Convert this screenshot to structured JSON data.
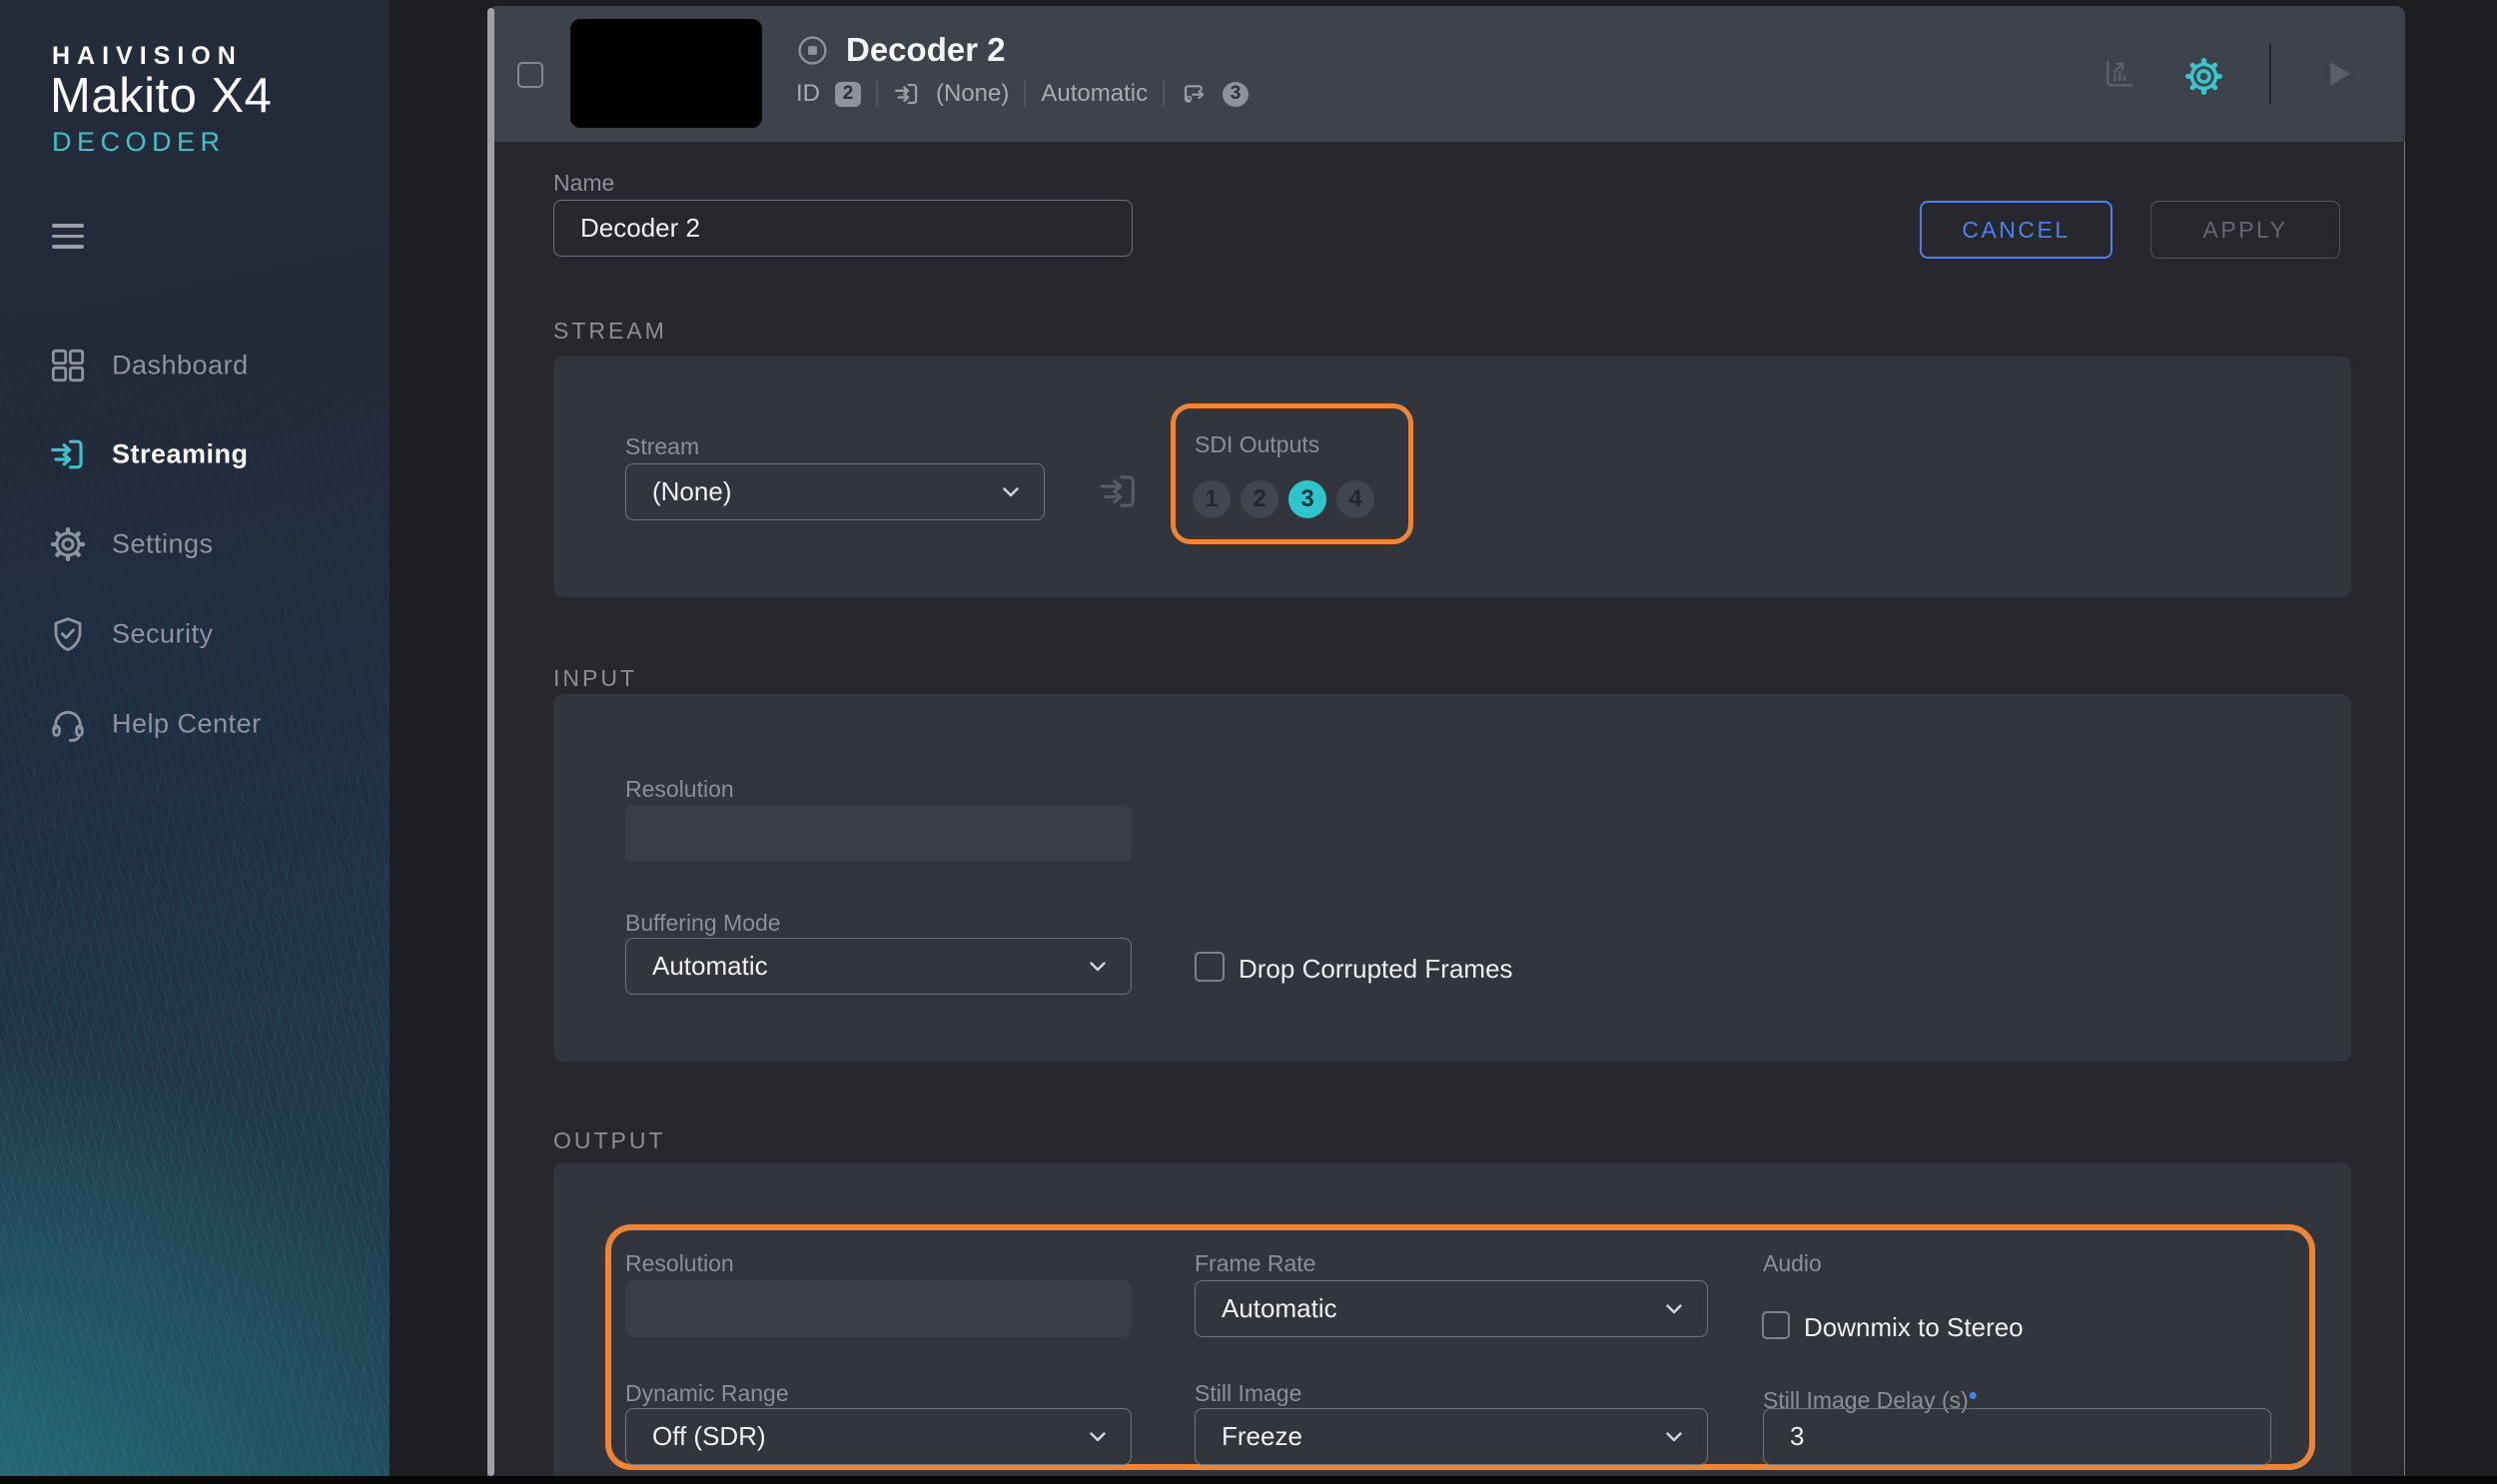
{
  "sidebar": {
    "brand": "HAIVISION",
    "product": "Makito X4",
    "mode": "DECODER",
    "items": [
      {
        "label": "Dashboard",
        "icon": "dashboard-icon",
        "active": false
      },
      {
        "label": "Streaming",
        "icon": "streaming-icon",
        "active": true
      },
      {
        "label": "Settings",
        "icon": "settings-icon",
        "active": false
      },
      {
        "label": "Security",
        "icon": "security-icon",
        "active": false
      },
      {
        "label": "Help Center",
        "icon": "help-center-icon",
        "active": false
      }
    ]
  },
  "panel": {
    "header": {
      "title": "Decoder 2",
      "id_label": "ID",
      "id_value": "2",
      "stream_value": "(None)",
      "mode_value": "Automatic",
      "outputs_count": "3"
    },
    "actions": {
      "cancel": "CANCEL",
      "apply": "APPLY"
    },
    "name": {
      "label": "Name",
      "value": "Decoder 2"
    }
  },
  "stream_section": {
    "heading": "STREAM",
    "stream_label": "Stream",
    "stream_value": "(None)",
    "sdi_label": "SDI Outputs",
    "sdi_outputs": [
      "1",
      "2",
      "3",
      "4"
    ],
    "sdi_active": "3"
  },
  "input_section": {
    "heading": "INPUT",
    "resolution_label": "Resolution",
    "resolution_value": "",
    "buffering_label": "Buffering Mode",
    "buffering_value": "Automatic",
    "drop_frames_label": "Drop Corrupted Frames",
    "drop_frames_checked": false
  },
  "output_section": {
    "heading": "OUTPUT",
    "resolution_label": "Resolution",
    "resolution_value": "",
    "frame_rate_label": "Frame Rate",
    "frame_rate_value": "Automatic",
    "audio_label": "Audio",
    "downmix_label": "Downmix to Stereo",
    "downmix_checked": false,
    "dynamic_range_label": "Dynamic Range",
    "dynamic_range_value": "Off (SDR)",
    "still_image_label": "Still Image",
    "still_image_value": "Freeze",
    "delay_label": "Still Image Delay (s)",
    "delay_marker": "•",
    "delay_value": "3"
  },
  "colors": {
    "accent_teal": "#3bc4cc",
    "annotation_orange": "#ed8538",
    "cancel_blue": "#4b81e8",
    "header_band": "#3e424b",
    "panel_body": "#26282d",
    "card": "#32353b"
  }
}
